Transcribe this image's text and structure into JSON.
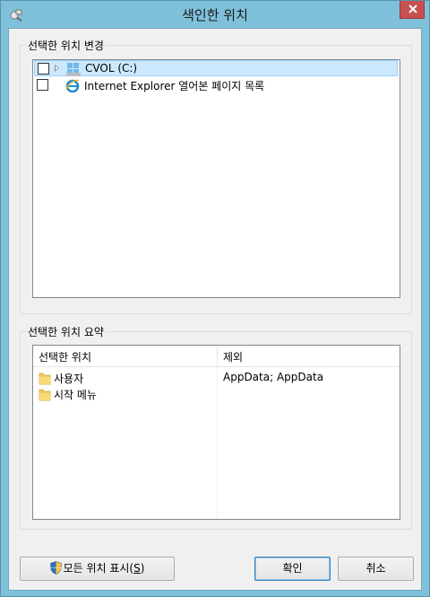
{
  "window": {
    "title": "색인한 위치",
    "icons": {
      "app": "indexing-options-icon",
      "close": "close-icon"
    }
  },
  "change_group": {
    "legend": "선택한 위치 변경",
    "items": [
      {
        "label": "CVOL (C:)",
        "checked": false,
        "icon": "drive-icon",
        "expandable": true,
        "selected": true
      },
      {
        "label": "Internet Explorer 열어본 페이지 목록",
        "checked": false,
        "icon": "internet-explorer-icon",
        "expandable": false,
        "selected": false
      }
    ]
  },
  "summary_group": {
    "legend": "선택한 위치 요약",
    "columns": [
      "선택한 위치",
      "제외"
    ],
    "rows": [
      {
        "location": "사용자",
        "exclude": "AppData; AppData",
        "icon": "folder-icon"
      },
      {
        "location": "시작 메뉴",
        "exclude": "",
        "icon": "folder-icon"
      }
    ]
  },
  "buttons": {
    "show_all": {
      "label": "모든 위치 표시(",
      "mnemonic": "S",
      "label_end": ")",
      "icon": "uac-shield-icon"
    },
    "ok": "확인",
    "cancel": "취소"
  },
  "colors": {
    "frame": "#7fc1da",
    "close": "#c75050",
    "selection": "#cce8ff"
  }
}
